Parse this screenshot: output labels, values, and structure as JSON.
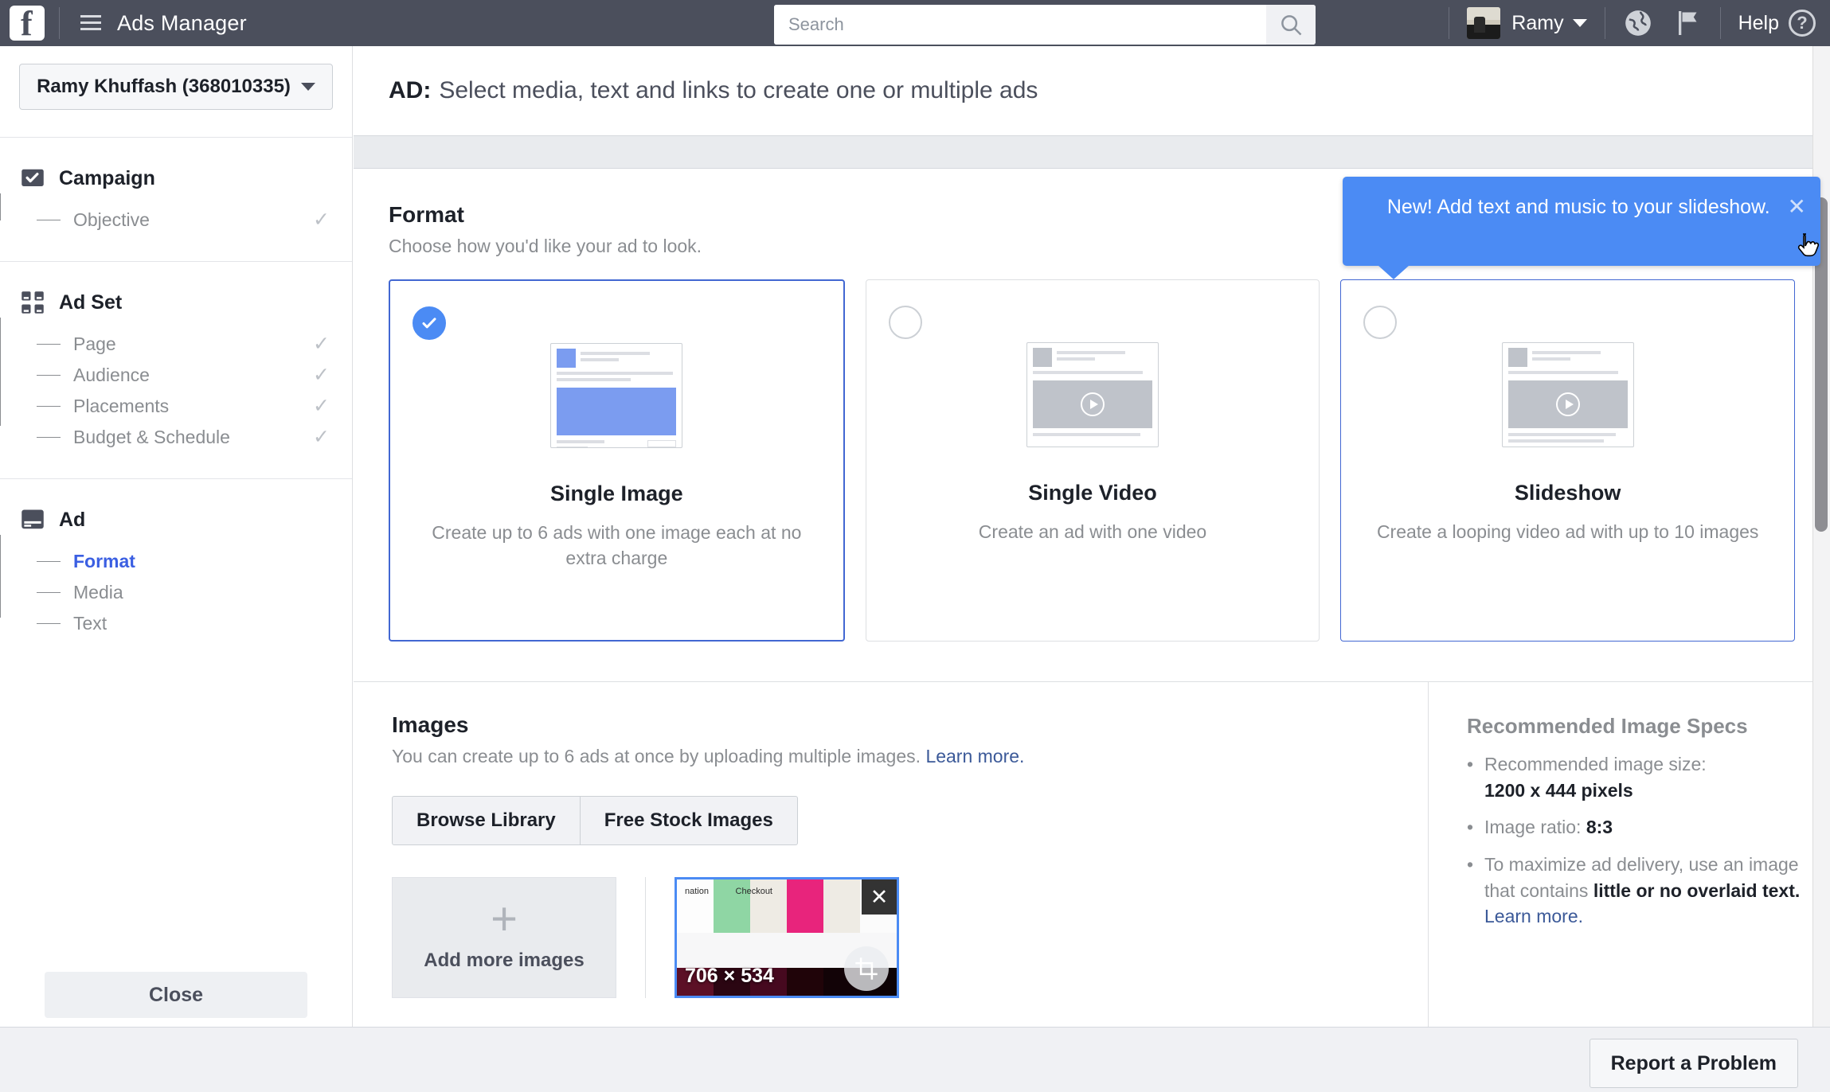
{
  "topbar": {
    "logo": "facebook-f",
    "app_title": "Ads Manager",
    "search_placeholder": "Search",
    "search_value": "",
    "user_name": "Ramy",
    "help_label": "Help",
    "icons": [
      "hamburger-icon",
      "search-icon",
      "globe-icon",
      "flag-icon",
      "question-icon"
    ]
  },
  "sidebar": {
    "account": "Ramy Khuffash (368010335)",
    "groups": [
      {
        "icon": "campaign-check-icon",
        "title": "Campaign",
        "items": [
          {
            "label": "Objective",
            "complete": true,
            "active": false
          }
        ]
      },
      {
        "icon": "ad-set-grid-icon",
        "title": "Ad Set",
        "items": [
          {
            "label": "Page",
            "complete": true,
            "active": false
          },
          {
            "label": "Audience",
            "complete": true,
            "active": false
          },
          {
            "label": "Placements",
            "complete": true,
            "active": false
          },
          {
            "label": "Budget & Schedule",
            "complete": true,
            "active": false
          }
        ]
      },
      {
        "icon": "ad-window-icon",
        "title": "Ad",
        "items": [
          {
            "label": "Format",
            "complete": false,
            "active": true
          },
          {
            "label": "Media",
            "complete": false,
            "active": false
          },
          {
            "label": "Text",
            "complete": false,
            "active": false
          }
        ]
      }
    ],
    "close_label": "Close"
  },
  "main": {
    "header_prefix": "AD:",
    "header_text": "Select media, text and links to create one or multiple ads",
    "format": {
      "title": "Format",
      "subtitle": "Choose how you'd like your ad to look.",
      "options": [
        {
          "id": "single-image",
          "title": "Single Image",
          "description": "Create up to 6 ads with one image each at no extra charge",
          "selected": true,
          "thumb": "single-image-preview"
        },
        {
          "id": "single-video",
          "title": "Single Video",
          "description": "Create an ad with one video",
          "selected": false,
          "thumb": "single-video-preview"
        },
        {
          "id": "slideshow",
          "title": "Slideshow",
          "description": "Create a looping video ad with up to 10 images",
          "selected": false,
          "thumb": "slideshow-preview"
        }
      ]
    },
    "images": {
      "title": "Images",
      "description": "You can create up to 6 ads at once by uploading multiple images.",
      "learn_more": "Learn more.",
      "browse_library": "Browse Library",
      "free_stock": "Free Stock Images",
      "add_more_label": "Add more images",
      "uploaded": [
        {
          "dimensions": "706 × 534",
          "remove_icon": "close-icon",
          "crop_icon": "crop-icon"
        }
      ]
    },
    "specs": {
      "title": "Recommended Image Specs",
      "items": [
        {
          "text": "Recommended image size:",
          "strong": "1200 x 444 pixels",
          "break_before_strong": true
        },
        {
          "text": "Image ratio: ",
          "strong": "8:3",
          "break_before_strong": false
        },
        {
          "text": "To maximize ad delivery, use an image that contains ",
          "strong": "little or no overlaid text.",
          "link": "Learn more.",
          "break_before_strong": false
        }
      ]
    }
  },
  "tooltip": {
    "message": "New! Add text and music to your slideshow.",
    "close_icon": "close-icon"
  },
  "footer": {
    "report_label": "Report a Problem"
  },
  "colors": {
    "chrome": "#4b4f5c",
    "accent_blue": "#4b8bf4",
    "link_blue": "#3b5998",
    "active_nav": "#3b5fe2",
    "band": "#e9ebee",
    "muted_text": "#8a8d91"
  }
}
